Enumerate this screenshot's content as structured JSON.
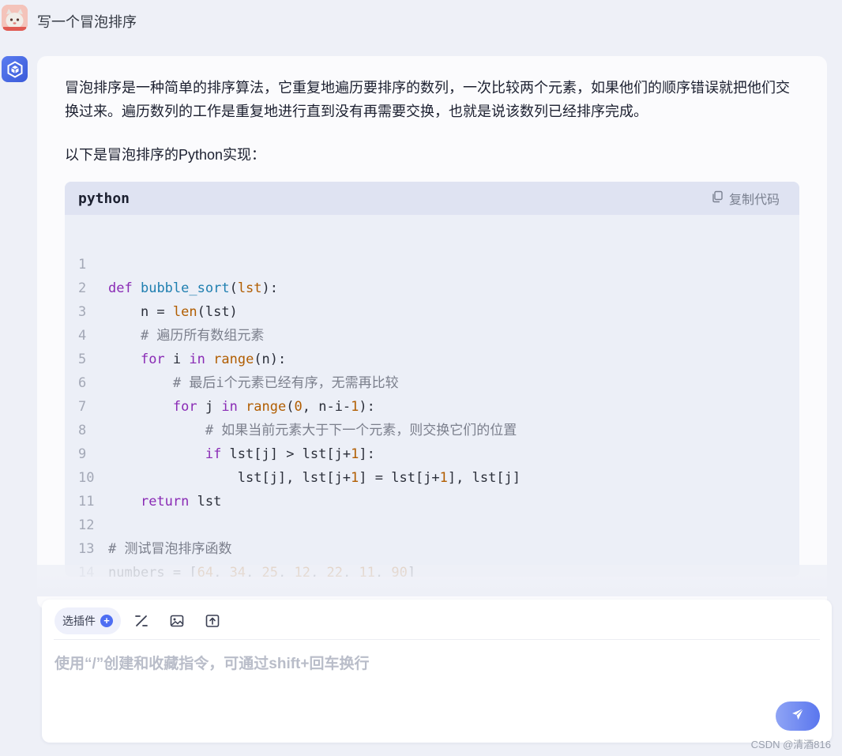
{
  "user": {
    "avatar_icon": "cat-avatar-icon",
    "message": "写一个冒泡排序"
  },
  "bot": {
    "avatar_icon": "cube-logo-icon",
    "paragraph1": "冒泡排序是一种简单的排序算法，它重复地遍历要排序的数列，一次比较两个元素，如果他们的顺序错误就把他们交换过来。遍历数列的工作是重复地进行直到没有再需要交换，也就是说该数列已经排序完成。",
    "paragraph2": "以下是冒泡排序的Python实现：",
    "code": {
      "language": "python",
      "copy_label": "复制代码",
      "line_numbers": [
        "1",
        "2",
        "3",
        "4",
        "5",
        "6",
        "7",
        "8",
        "9",
        "10",
        "11",
        "12",
        "13",
        "14"
      ],
      "comments": {
        "c3": "# 遍历所有数组元素",
        "c5": "# 最后i个元素已经有序，无需再比较",
        "c7": "# 如果当前元素大于下一个元素，则交换它们的位置",
        "c12": "# 测试冒泡排序函数"
      }
    }
  },
  "input": {
    "plugin_label": "选插件",
    "placeholder": "使用“/”创建和收藏指令，可通过shift+回车换行",
    "tools": [
      "slash-command-icon",
      "image-icon",
      "upload-icon"
    ],
    "send_icon": "send-icon"
  },
  "watermark": "CSDN @清酒816",
  "colors": {
    "keyword": "#8a2bb5",
    "function": "#1f7fb0",
    "number": "#b15d00",
    "accent": "#4e6ef2"
  }
}
